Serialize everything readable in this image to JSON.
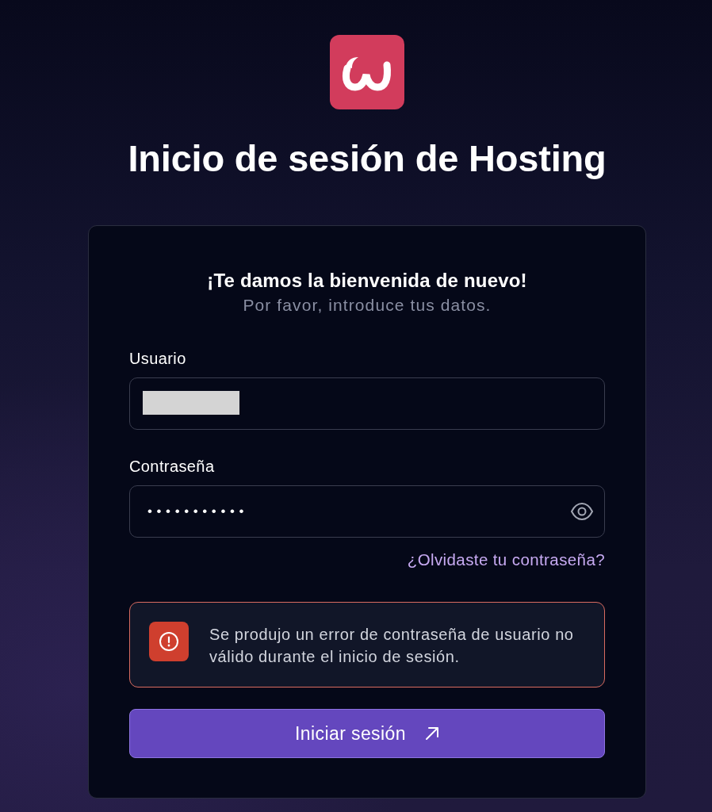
{
  "page": {
    "title": "Inicio de sesión de Hosting"
  },
  "card": {
    "heading": "¡Te damos la bienvenida de nuevo!",
    "subheading": "Por favor, introduce tus datos."
  },
  "fields": [
    {
      "kind": "text",
      "label": "Usuario",
      "redacted": true
    },
    {
      "kind": "password",
      "label": "Contraseña",
      "value": "•••••••••••",
      "reveal_toggle": true
    }
  ],
  "forgot_link": "¿Olvidaste tu contraseña?",
  "alert": {
    "kind": "error",
    "message": "Se produjo un error de contraseña de usuario no válido durante el inicio de sesión."
  },
  "submit_button": {
    "label": "Iniciar sesión"
  }
}
